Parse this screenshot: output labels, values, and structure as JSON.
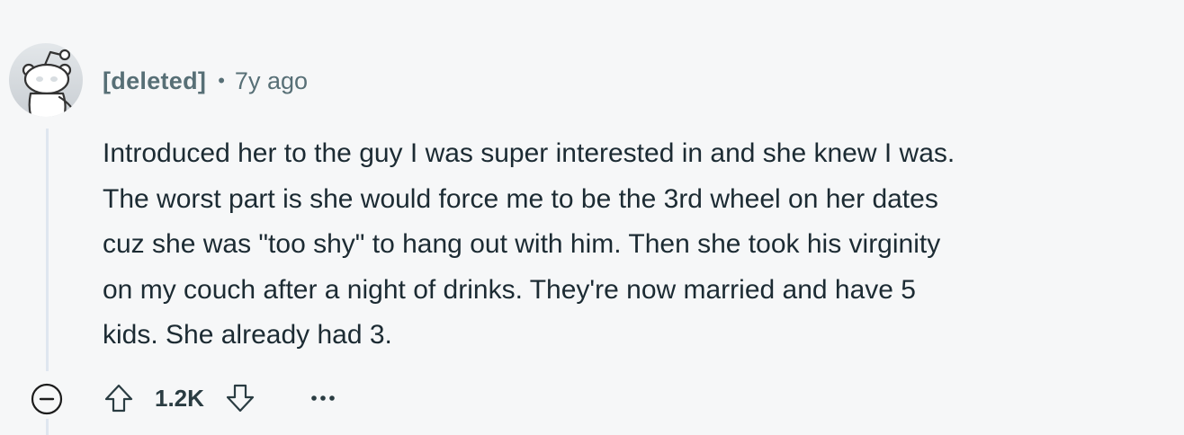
{
  "comment": {
    "author": "[deleted]",
    "separator": "•",
    "time_ago": "7y ago",
    "body": "Introduced her to the guy I was super interested in and she knew I was.\nThe worst part is she would force me to be the 3rd wheel on her dates\ncuz she was \"too shy\" to hang out with him. Then she took his virginity\non my couch after a night of drinks. They're now married and have 5\nkids. She already had 3.",
    "score": "1.2K",
    "avatar_icon": "snoo-avatar-icon",
    "collapse_icon": "collapse-minus-icon",
    "upvote_icon": "upvote-arrow-icon",
    "downvote_icon": "downvote-arrow-icon",
    "more_icon": "more-options-icon"
  },
  "colors": {
    "background": "#f6f7f8",
    "meta_text": "#576f76",
    "body_text": "#1c2b33",
    "thread_line": "#dfe6ef"
  }
}
